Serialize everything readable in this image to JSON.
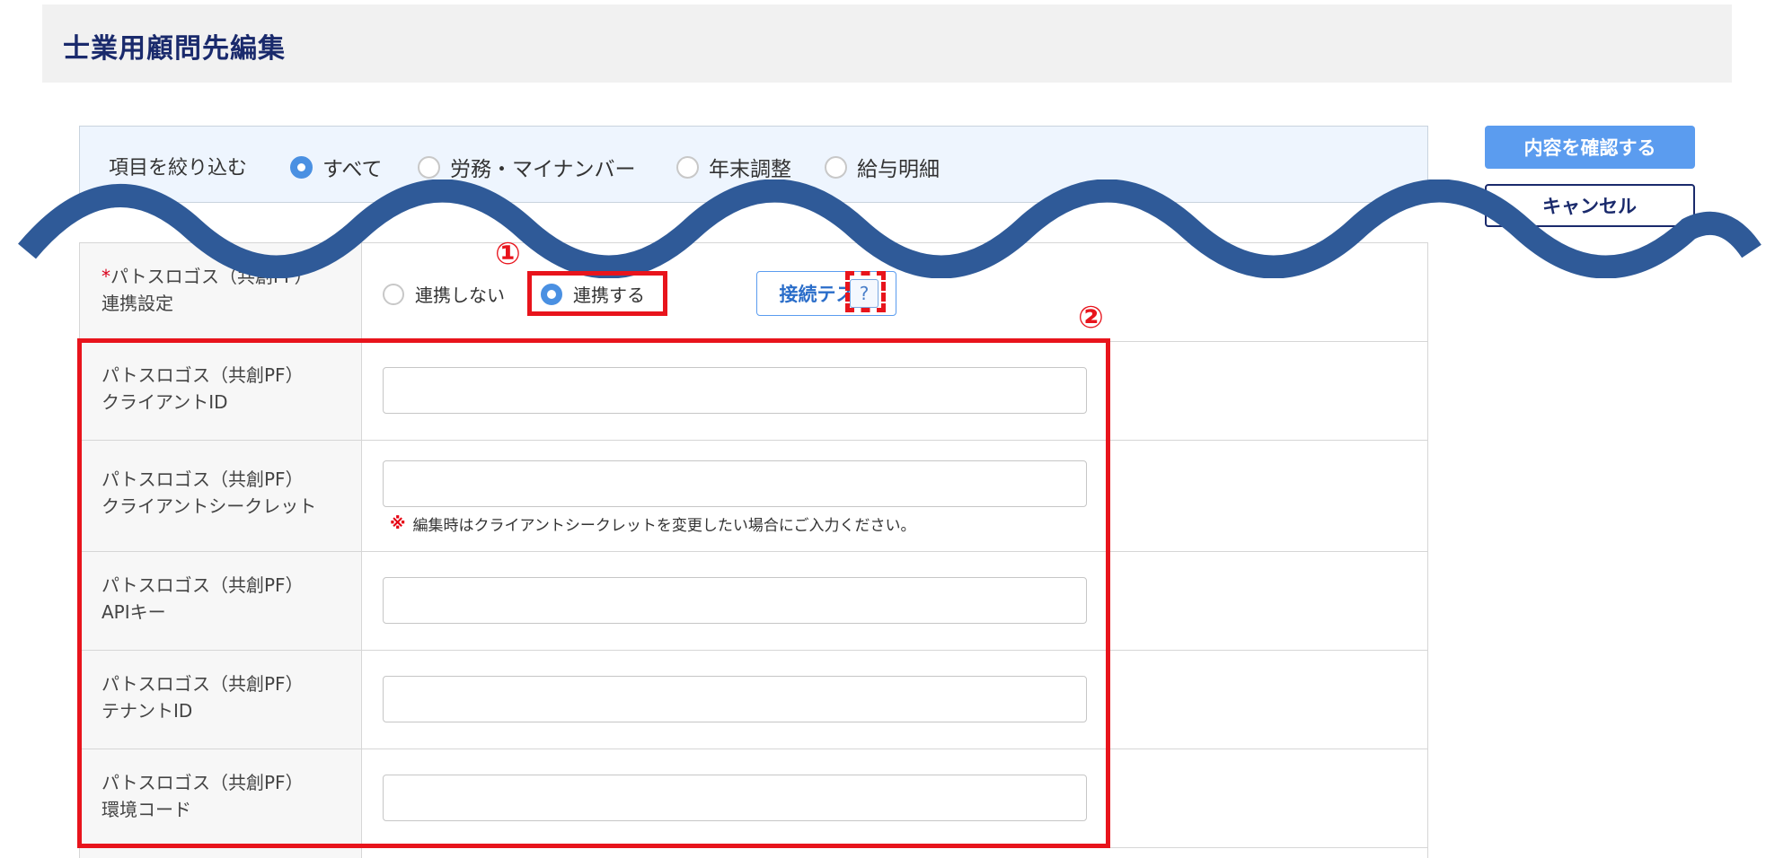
{
  "page": {
    "title": "士業用顧問先編集"
  },
  "filter": {
    "label": "項目を絞り込む",
    "options": [
      {
        "label": "すべて",
        "checked": true
      },
      {
        "label": "労務・マイナンバー",
        "checked": false
      },
      {
        "label": "年末調整",
        "checked": false
      },
      {
        "label": "給与明細",
        "checked": false
      }
    ]
  },
  "actions": {
    "confirm_label": "内容を確認する",
    "cancel_label": "キャンセル"
  },
  "integration": {
    "required_mark": "*",
    "label": "パトスロゴス（共創PF）\n連携設定",
    "options": [
      {
        "label": "連携しない",
        "checked": false
      },
      {
        "label": "連携する",
        "checked": true
      }
    ],
    "test_button": "接続テスト",
    "help_icon": "?"
  },
  "fields": [
    {
      "label": "パトスロゴス（共創PF）\nクライアントID",
      "value": "",
      "placeholder": ""
    },
    {
      "label": "パトスロゴス（共創PF）\nクライアントシークレット",
      "value": "",
      "placeholder": "",
      "note_mark": "※",
      "note": "編集時はクライアントシークレットを変更したい場合にご入力ください。"
    },
    {
      "label": "パトスロゴス（共創PF）\nAPIキー",
      "value": "",
      "placeholder": ""
    },
    {
      "label": "パトスロゴス（共創PF）\nテナントID",
      "value": "",
      "placeholder": ""
    },
    {
      "label": "パトスロゴス（共創PF）\n環境コード",
      "value": "",
      "placeholder": ""
    }
  ],
  "annotations": {
    "marker1": "①",
    "marker2": "②"
  },
  "colors": {
    "title": "#1a2a6c",
    "accent": "#5b9cef",
    "highlight": "#e8141c",
    "wave": "#2f5a98",
    "filter_bg": "#eef5fe"
  },
  "icons": {
    "help": "question-icon",
    "note": "asterisk-note-icon"
  }
}
